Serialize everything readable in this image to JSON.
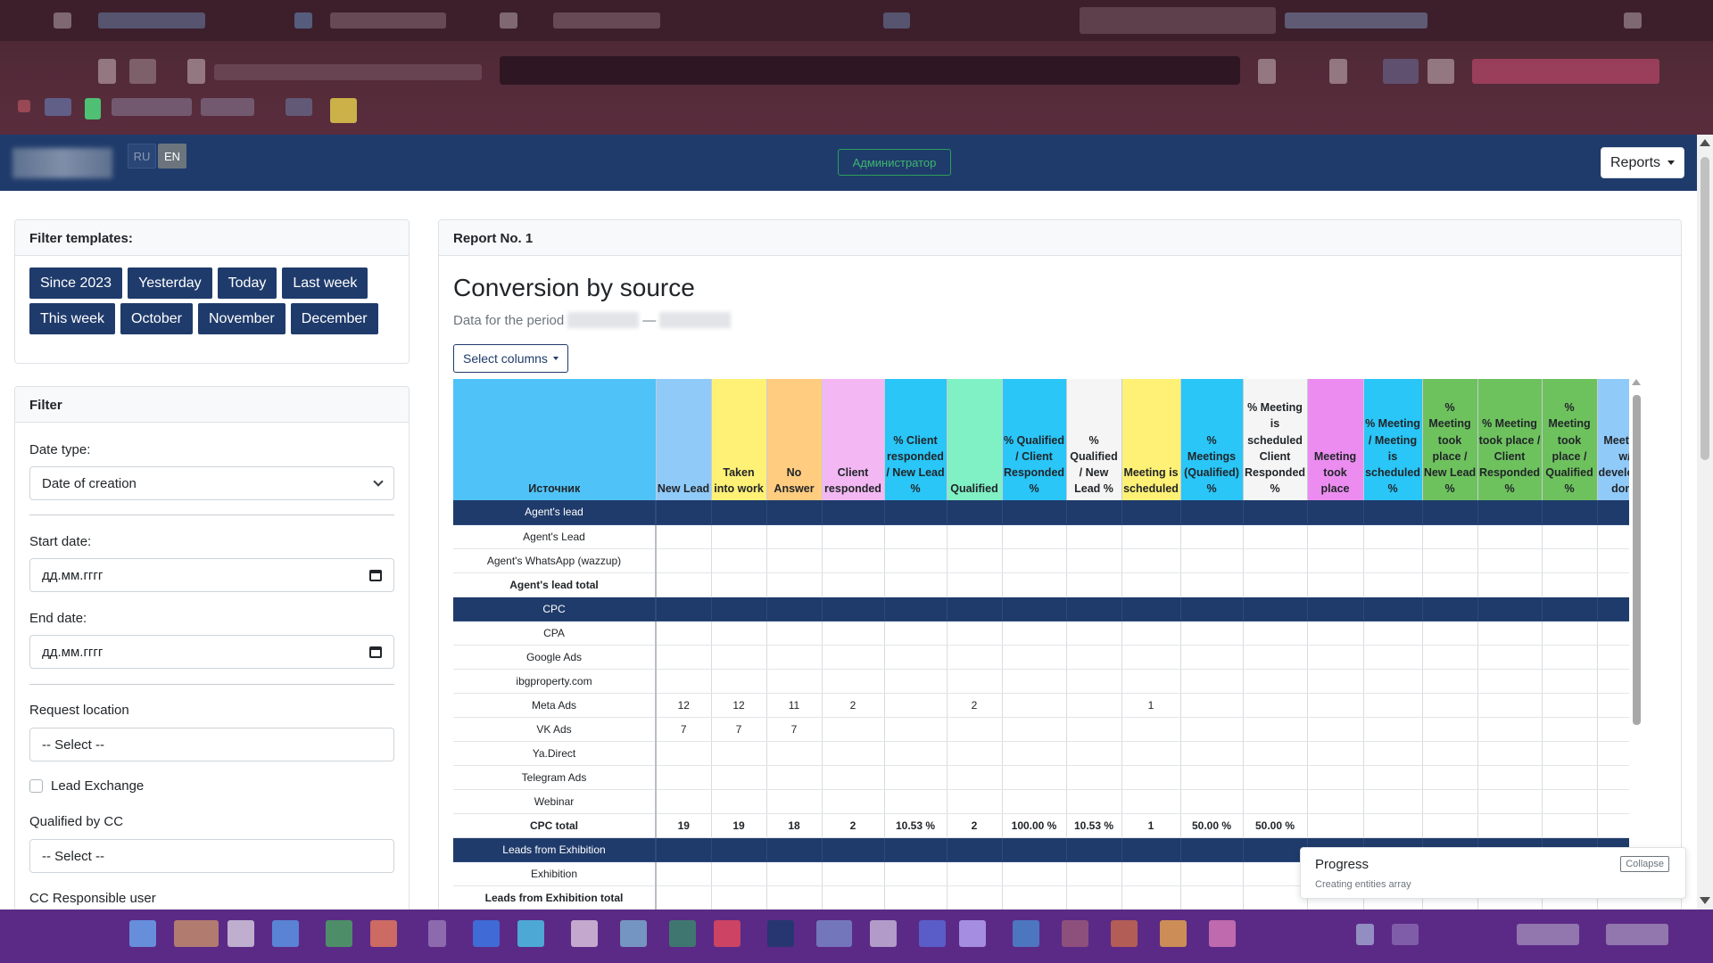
{
  "nav": {
    "lang_ru": "RU",
    "lang_en": "EN",
    "admin_label": "Администратор",
    "reports_label": "Reports"
  },
  "templates": {
    "title": "Filter templates:",
    "buttons": [
      "Since 2023",
      "Yesterday",
      "Today",
      "Last week",
      "This week",
      "October",
      "November",
      "December"
    ]
  },
  "filter": {
    "title": "Filter",
    "date_type_label": "Date type:",
    "date_type_value": "Date of creation",
    "start_date_label": "Start date:",
    "start_date_placeholder": "дд.мм.гггг",
    "end_date_label": "End date:",
    "end_date_placeholder": "дд.мм.гггг",
    "request_location_label": "Request location",
    "request_location_value": "-- Select --",
    "lead_exchange_label": "Lead Exchange",
    "qualified_by_cc_label": "Qualified by CC",
    "qualified_by_cc_value": "-- Select --",
    "cc_responsible_label": "CC Responsible user"
  },
  "report": {
    "header": "Report No. 1",
    "title": "Conversion by source",
    "period_prefix": "Data for the period",
    "period_sep": "—",
    "select_columns_label": "Select columns",
    "columns": [
      {
        "label": "Источник",
        "color": "#4fc3f7",
        "width": 227
      },
      {
        "label": "New Lead",
        "color": "#90caf9",
        "width": 62
      },
      {
        "label": "Taken into work",
        "color": "#fff176",
        "width": 62
      },
      {
        "label": "No Answer",
        "color": "#ffcc80",
        "width": 62
      },
      {
        "label": "Client responded",
        "color": "#f3b8f3",
        "width": 70
      },
      {
        "label": "% Client responded / New Lead %",
        "color": "#29c6f7",
        "width": 70
      },
      {
        "label": "Qualified",
        "color": "#80f0c5",
        "width": 62
      },
      {
        "label": "% Qualified / Client Responded %",
        "color": "#29c6f7",
        "width": 72
      },
      {
        "label": "% Qualified / New Lead %",
        "color": "#f5f5f5",
        "width": 62
      },
      {
        "label": "Meeting is scheduled",
        "color": "#fff176",
        "width": 66
      },
      {
        "label": "% Meetings (Qualified) %",
        "color": "#29c6f7",
        "width": 70
      },
      {
        "label": "% Meeting is scheduled Client Responded %",
        "color": "#f5f5f5",
        "width": 72
      },
      {
        "label": "Meeting took place",
        "color": "#ec8cf0",
        "width": 63
      },
      {
        "label": "% Meeting / Meeting is scheduled %",
        "color": "#29c6f7",
        "width": 66
      },
      {
        "label": "% Meeting took place / New Lead %",
        "color": "#6ec25e",
        "width": 62
      },
      {
        "label": "% Meeting took place / Client Responded %",
        "color": "#6ec25e",
        "width": 72
      },
      {
        "label": "% Meeting took place / Qualified %",
        "color": "#6ec25e",
        "width": 62
      },
      {
        "label": "Meeting w/ developer done",
        "color": "#90caf9",
        "width": 62
      }
    ],
    "rows": [
      {
        "type": "group",
        "cells": [
          "Agent's lead"
        ]
      },
      {
        "type": "row",
        "cells": [
          "Agent's Lead"
        ]
      },
      {
        "type": "row",
        "cells": [
          "Agent's WhatsApp (wazzup)"
        ]
      },
      {
        "type": "total",
        "cells": [
          "Agent's lead total"
        ]
      },
      {
        "type": "group",
        "cells": [
          "CPC"
        ]
      },
      {
        "type": "row",
        "cells": [
          "CPA"
        ]
      },
      {
        "type": "row",
        "cells": [
          "Google Ads"
        ]
      },
      {
        "type": "row",
        "cells": [
          "ibgproperty.com"
        ]
      },
      {
        "type": "row",
        "cells": [
          "Meta Ads",
          "12",
          "12",
          "11",
          "2",
          "",
          "2",
          "",
          "",
          "1"
        ]
      },
      {
        "type": "row",
        "cells": [
          "VK Ads",
          "7",
          "7",
          "7"
        ]
      },
      {
        "type": "row",
        "cells": [
          "Ya.Direct"
        ]
      },
      {
        "type": "row",
        "cells": [
          "Telegram Ads"
        ]
      },
      {
        "type": "row",
        "cells": [
          "Webinar"
        ]
      },
      {
        "type": "total",
        "cells": [
          "CPC total",
          "19",
          "19",
          "18",
          "2",
          "10.53 %",
          "2",
          "100.00 %",
          "10.53 %",
          "1",
          "50.00 %",
          "50.00 %"
        ]
      },
      {
        "type": "group",
        "cells": [
          "Leads from Exhibition"
        ]
      },
      {
        "type": "row",
        "cells": [
          "Exhibition"
        ]
      },
      {
        "type": "total",
        "cells": [
          "Leads from Exhibition total"
        ]
      }
    ]
  },
  "progress": {
    "title": "Progress",
    "subtitle": "Creating entities array",
    "collapse_label": "Collapse"
  }
}
